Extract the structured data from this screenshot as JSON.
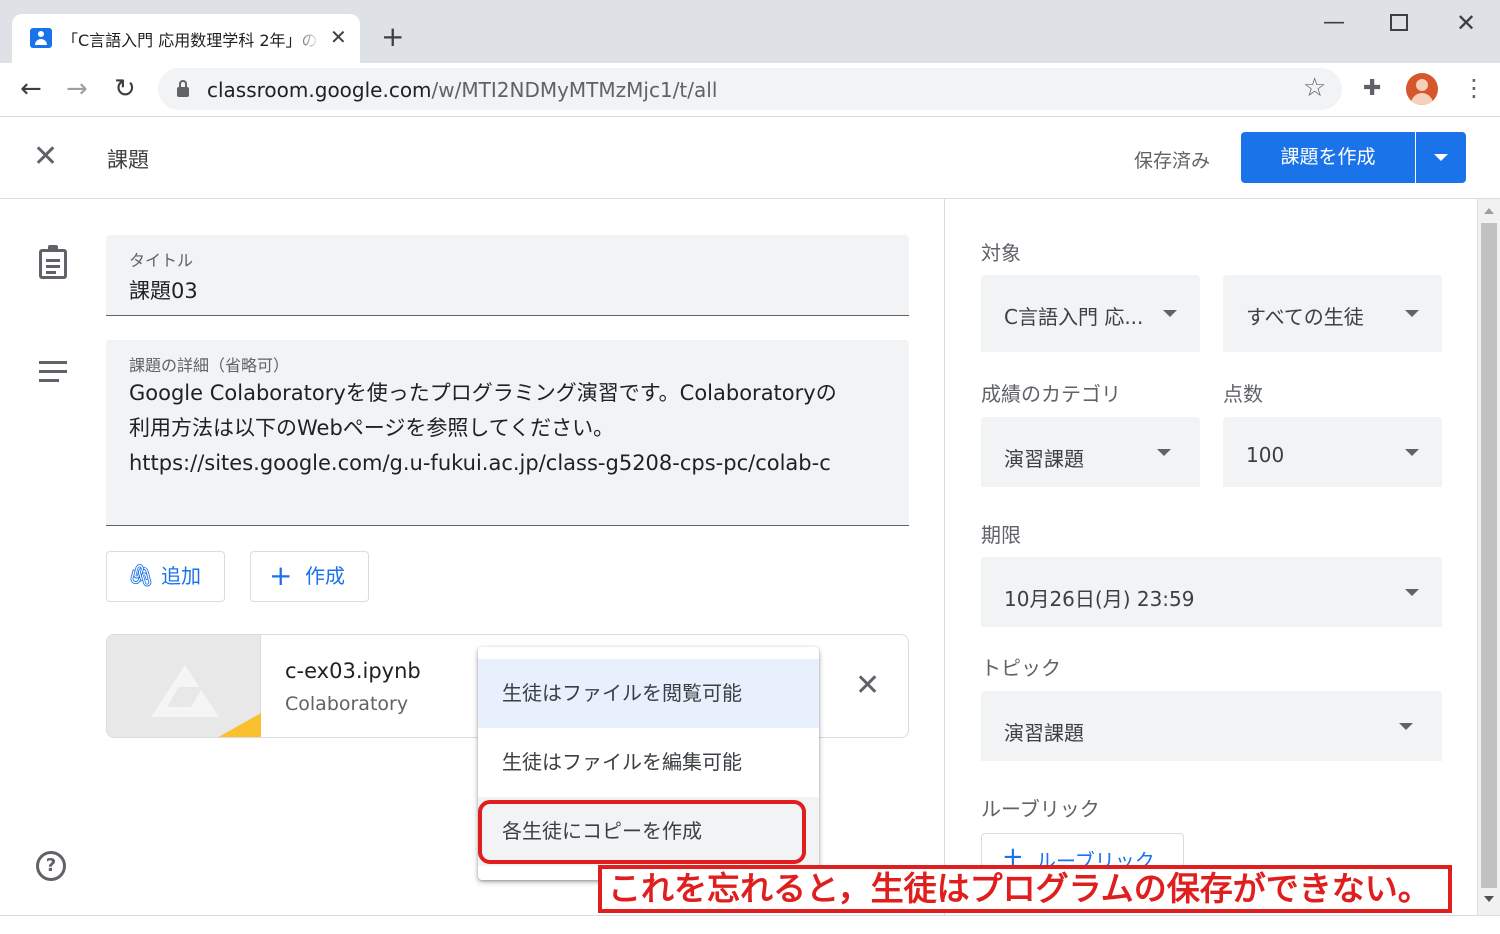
{
  "browser": {
    "tab_title": "「C言語入門 応用数理学科 2年」の",
    "tab_close_icon": "✕",
    "new_tab_icon": "+",
    "url_host": "classroom.google.com",
    "url_path": "/w/MTI2NDMyMTMzMjc1/t/all",
    "icons": [
      "back-arrow-icon",
      "forward-arrow-icon",
      "reload-icon",
      "lock-icon",
      "star-icon",
      "extensions-icon",
      "profile-avatar",
      "more-vert-icon"
    ]
  },
  "header": {
    "title": "課題",
    "save_status": "保存済み",
    "create_button": "課題を作成"
  },
  "form": {
    "title_label": "タイトル",
    "title_value": "課題03",
    "details_label": "課題の詳細（省略可）",
    "details_value": "Google Colaboratoryを使ったプログラミング演習です。Colaboratoryの\n利用方法は以下のWebページを参照してください。\nhttps://sites.google.com/g.u-fukui.ac.jp/class-g5208-cps-pc/colab-c",
    "add_button": "追加",
    "create_button": "作成",
    "attachment": {
      "name": "c-ex03.ipynb",
      "type": "Colaboratory"
    }
  },
  "share_menu": {
    "items": [
      "生徒はファイルを閲覧可能",
      "生徒はファイルを編集可能",
      "各生徒にコピーを作成"
    ],
    "selected_index": 0
  },
  "side_panel": {
    "for_label": "対象",
    "class_value": "C言語入門 応...",
    "students_value": "すべての生徒",
    "category_label": "成績のカテゴリ",
    "points_label": "点数",
    "category_value": "演習課題",
    "points_value": "100",
    "due_label": "期限",
    "due_value": "10月26日(月) 23:59",
    "topic_label": "トピック",
    "topic_value": "演習課題",
    "rubric_label": "ルーブリック",
    "rubric_button": "ルーブリック"
  },
  "annotation": {
    "text": "これを忘れると，生徒はプログラムの保存ができない。",
    "color": "#e01e1e"
  }
}
